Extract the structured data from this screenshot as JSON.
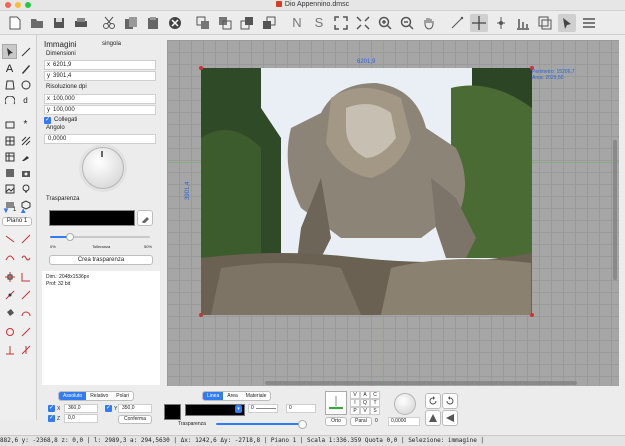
{
  "window": {
    "title": "Dio Appennino.dmsc"
  },
  "toolbar": {
    "icons": [
      "new-file-icon",
      "open-folder-icon",
      "save-icon",
      "print-icon",
      "cut-icon",
      "copy-icon",
      "paste-icon",
      "delete-icon",
      "group-icon",
      "ungroup-icon",
      "bring-front-icon",
      "send-back-icon",
      "N",
      "S",
      "fit-page-icon",
      "zoom-fit-icon",
      "zoom-in-icon",
      "zoom-out-icon",
      "hand-icon",
      "line-tool-icon",
      "crosshair-icon",
      "snap-icon",
      "align-icon",
      "layers-icon",
      "select-icon",
      "menu-icon"
    ]
  },
  "panel": {
    "title": "Immagini",
    "mode": "singola",
    "dimensions_label": "Dimensioni",
    "x_prefix": "x",
    "x_value": "6201,9",
    "y_prefix": "y",
    "y_value": "3901,4",
    "resolution_label": "Risoluzione dpi",
    "res_x": "100,000",
    "res_y": "100,000",
    "linked_label": "Collegati",
    "angle_label": "Angolo",
    "angle_value": "0,0000",
    "transparency_label": "Trasparenza",
    "tol_min": "0%",
    "tol_label": "Tolleranza",
    "tol_max": "50%",
    "tolerance_value": 0.2,
    "create_button": "Crea trasparenza",
    "info_dim": "Dim.: 2048x1536px",
    "info_prof": "Prof: 32 bit"
  },
  "lefttools": {
    "page_label": "Piano 1",
    "page_number": "1"
  },
  "canvas": {
    "width_label": "6201,9",
    "height_label": "3901,4",
    "perimeter": "Perimetro: 15206,7",
    "area": "Area: 2029,50"
  },
  "bottom": {
    "coord_tabs": [
      "Assoluto",
      "Relativo",
      "Polari"
    ],
    "x_label": "X",
    "x_value": "360,0",
    "y_label": "Y",
    "y_value": "350,0",
    "z_label": "Z",
    "z_value": "0,0",
    "confirm": "Conferma",
    "line_tabs": [
      "Linea",
      "Area",
      "Materiale"
    ],
    "spin1": "0",
    "spin2": "0",
    "transparency_label": "Trasparenza",
    "orto": "Orto",
    "paral": "Paral",
    "paral_value": "0",
    "grid_letters": [
      "V",
      "A",
      "C",
      "I",
      "Q",
      "T",
      "P",
      "V",
      "S"
    ],
    "value_field": "0,0000"
  },
  "status": {
    "text": "882,6 y:    -2368,8 z:       0,0 | l:   2989,3 a: 294,5630 | Δx:   1242,6 Δy:   -2718,8 | Piano 1 | Scala 1:336.359 Quota 0,0 | Selezione: immagine |"
  },
  "colors": {
    "accent": "#2f7cf6",
    "close": "#ff5f57",
    "minimize": "#febc2e",
    "zoom": "#28c840",
    "canvas_bg": "#a6a6a6",
    "dim_text": "#2a64d6",
    "info_text": "#2a64d6"
  }
}
